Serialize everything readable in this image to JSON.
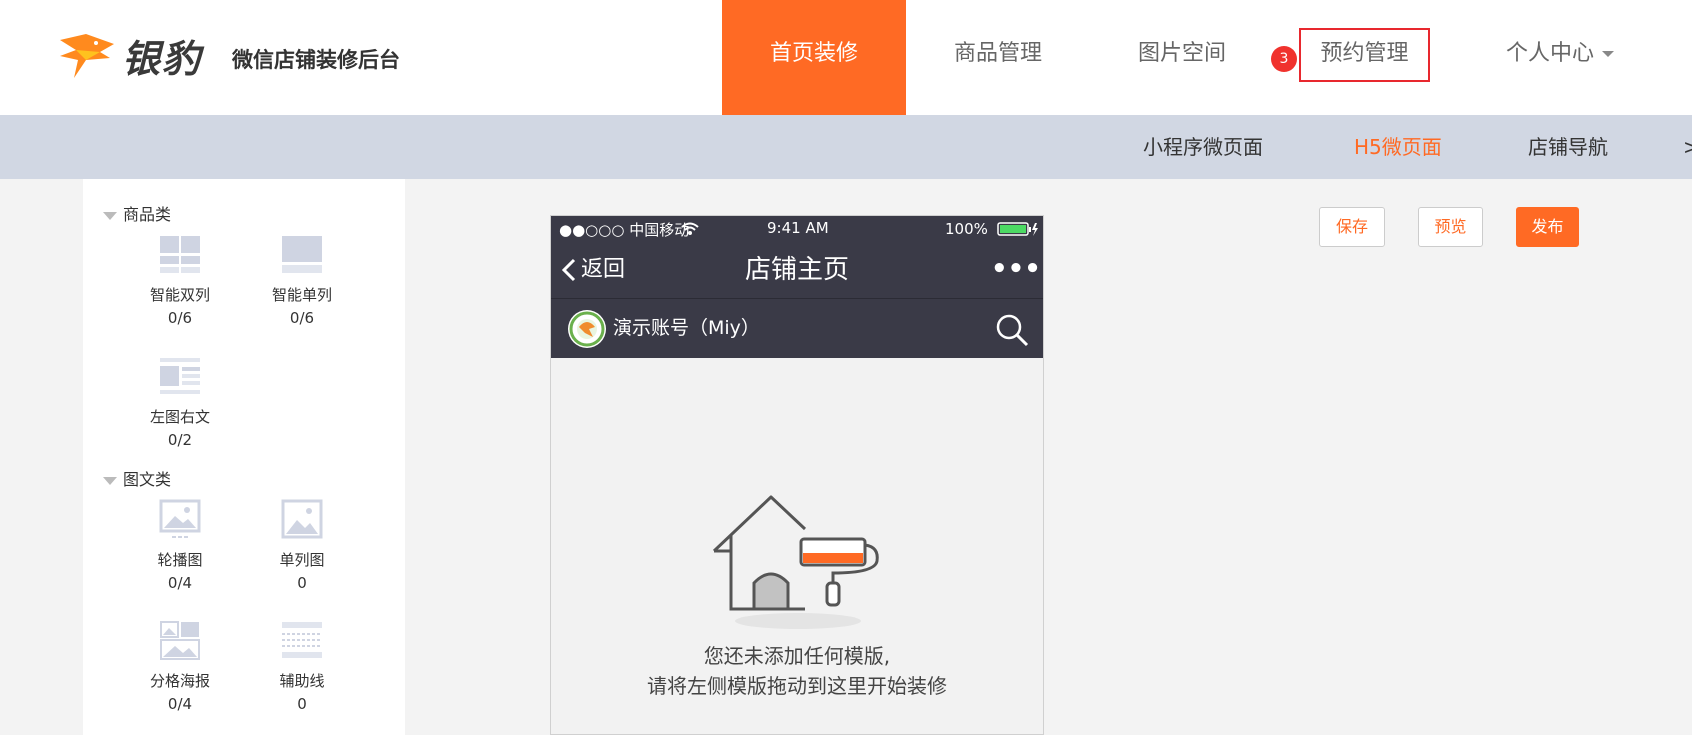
{
  "brand": {
    "name": "银豹",
    "subtitle": "微信店铺装修后台",
    "accent": "#ff6a24"
  },
  "nav": {
    "items": [
      {
        "label": "首页装修",
        "active": true
      },
      {
        "label": "商品管理"
      },
      {
        "label": "图片空间"
      },
      {
        "label": "预约管理",
        "badge": "3",
        "highlighted": true
      },
      {
        "label": "个人中心",
        "dropdown": true
      }
    ]
  },
  "subnav": {
    "items": [
      {
        "label": "小程序微页面"
      },
      {
        "label": "H5微页面",
        "active": true
      },
      {
        "label": "店铺导航"
      }
    ],
    "more": ">"
  },
  "widgets": {
    "categories": [
      {
        "title": "商品类",
        "items": [
          {
            "label": "智能双列",
            "count": "0/6",
            "icon": "double-column-icon"
          },
          {
            "label": "智能单列",
            "count": "0/6",
            "icon": "single-column-icon"
          },
          {
            "label": "左图右文",
            "count": "0/2",
            "icon": "left-image-right-text-icon"
          }
        ]
      },
      {
        "title": "图文类",
        "items": [
          {
            "label": "轮播图",
            "count": "0/4",
            "icon": "carousel-image-icon"
          },
          {
            "label": "单列图",
            "count": "0",
            "icon": "single-image-icon"
          },
          {
            "label": "分格海报",
            "count": "0/4",
            "icon": "grid-poster-icon"
          },
          {
            "label": "辅助线",
            "count": "0",
            "icon": "divider-line-icon"
          }
        ]
      }
    ]
  },
  "phone": {
    "status": {
      "carrier": "●●○○○ 中国移动",
      "time": "9:41 AM",
      "battery": "100%"
    },
    "back_label": "返回",
    "title": "店铺主页",
    "more": "•••",
    "shop_name": "演示账号（Miy）",
    "empty_line1": "您还未添加任何模版,",
    "empty_line2": "请将左侧模版拖动到这里开始装修"
  },
  "actions": {
    "save": "保存",
    "preview": "预览",
    "publish": "发布"
  }
}
